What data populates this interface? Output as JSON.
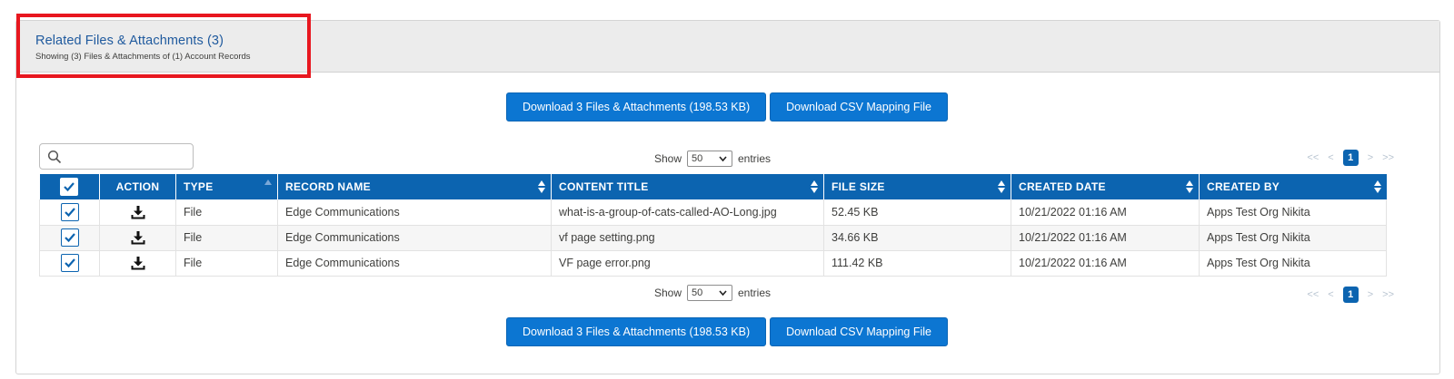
{
  "panel": {
    "title": "Related Files & Attachments (3)",
    "subtitle": "Showing (3) Files & Attachments of (1) Account Records"
  },
  "buttons": {
    "download_all_label": "Download 3 Files & Attachments (198.53 KB)",
    "download_csv_label": "Download CSV Mapping File"
  },
  "search": {
    "value": "",
    "placeholder": ""
  },
  "entries": {
    "show_label": "Show",
    "selected": "50",
    "entries_label": "entries"
  },
  "pager": {
    "first": "<<",
    "prev": "<",
    "current": "1",
    "next": ">",
    "last": ">>"
  },
  "table": {
    "columns": [
      "ACTION",
      "TYPE",
      "RECORD NAME",
      "CONTENT TITLE",
      "FILE SIZE",
      "CREATED DATE",
      "CREATED BY"
    ],
    "rows": [
      {
        "type": "File",
        "record_name": "Edge Communications",
        "content_title": "what-is-a-group-of-cats-called-AO-Long.jpg",
        "file_size": "52.45 KB",
        "created_date": "10/21/2022 01:16 AM",
        "created_by": "Apps Test Org Nikita"
      },
      {
        "type": "File",
        "record_name": "Edge Communications",
        "content_title": "vf page setting.png",
        "file_size": "34.66 KB",
        "created_date": "10/21/2022 01:16 AM",
        "created_by": "Apps Test Org Nikita"
      },
      {
        "type": "File",
        "record_name": "Edge Communications",
        "content_title": "VF page error.png",
        "file_size": "111.42 KB",
        "created_date": "10/21/2022 01:16 AM",
        "created_by": "Apps Test Org Nikita"
      }
    ]
  },
  "colors": {
    "accent": "#0c76d2",
    "header_blue": "#0c64b0",
    "link": "#1a72c8",
    "highlight": "#e8171f"
  }
}
